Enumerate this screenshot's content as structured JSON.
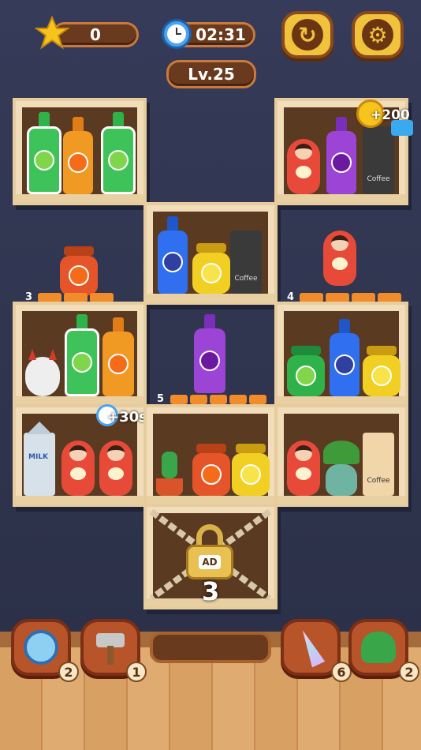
{
  "hud": {
    "stars": "0",
    "timer": "02:31",
    "level": "Lv.25",
    "restart_icon": "restart-icon",
    "settings_icon": "gear-icon"
  },
  "rewards": {
    "coin_bonus": "+200",
    "time_bonus": "+30s"
  },
  "trays": {
    "left_label": "3",
    "right_label": "4",
    "center_label": "5"
  },
  "locked_shelf": {
    "count": "3",
    "ad_label": "AD"
  },
  "product_labels": {
    "milk": "MILK",
    "coffee": "Coffee"
  },
  "toolbar": {
    "compass_count": "2",
    "hammer_count": "1",
    "horn_count": "6",
    "dino_count": "2"
  },
  "colors": {
    "orange_slot": "#f28b2a",
    "shelf": "#f1ddb9",
    "background": "#2e3450"
  }
}
